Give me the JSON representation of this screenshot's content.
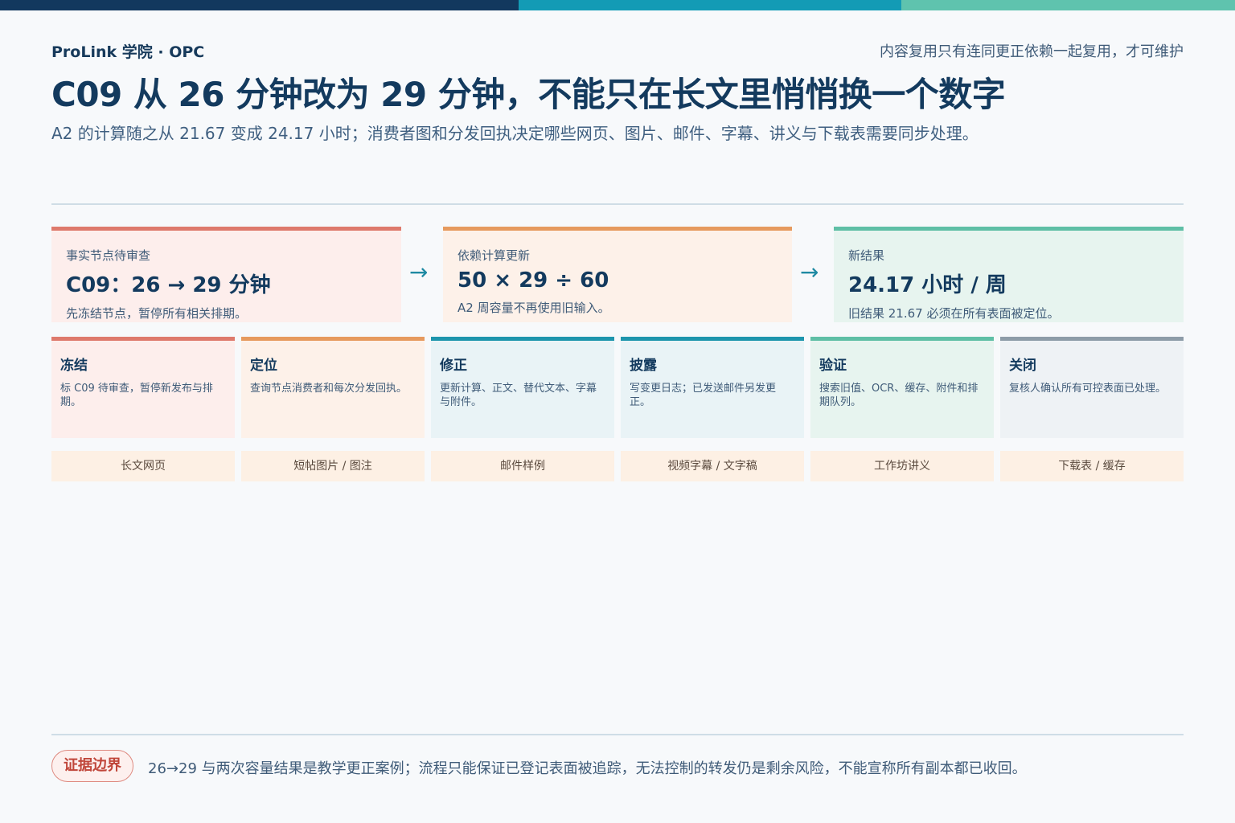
{
  "header": {
    "brand": "ProLink 学院 · OPC",
    "tagline": "内容复用只有连同更正依赖一起复用，才可维护",
    "title": "C09 从 26 分钟改为 29 分钟，不能只在长文里悄悄换一个数字",
    "subtitle": "A2 的计算随之从 21.67 变成 24.17 小时；消费者图和分发回执决定哪些网页、图片、邮件、字幕、讲义与下载表需要同步处理。"
  },
  "flow": [
    {
      "label": "事实节点待审查",
      "value": "C09：26 → 29 分钟",
      "note": "先冻结节点，暂停所有相关排期。"
    },
    {
      "label": "依赖计算更新",
      "value": "50 × 29 ÷ 60",
      "note": "A2 周容量不再使用旧输入。"
    },
    {
      "label": "新结果",
      "value": "24.17 小时 / 周",
      "note": "旧结果 21.67 必须在所有表面被定位。"
    }
  ],
  "flow_arrow": "→",
  "steps": [
    {
      "name": "冻结",
      "desc": "标 C09 待审查，暂停新发布与排期。"
    },
    {
      "name": "定位",
      "desc": "查询节点消费者和每次分发回执。"
    },
    {
      "name": "修正",
      "desc": "更新计算、正文、替代文本、字幕与附件。"
    },
    {
      "name": "披露",
      "desc": "写变更日志；已发送邮件另发更正。"
    },
    {
      "name": "验证",
      "desc": "搜索旧值、OCR、缓存、附件和排期队列。"
    },
    {
      "name": "关闭",
      "desc": "复核人确认所有可控表面已处理。"
    }
  ],
  "surfaces": [
    "长文网页",
    "短帖图片 / 图注",
    "邮件样例",
    "视频字幕 / 文字稿",
    "工作坊讲义",
    "下载表 / 缓存"
  ],
  "footer": {
    "badge": "证据边界",
    "text": "26→29 与两次容量结果是教学更正案例；流程只能保证已登记表面被追踪，无法控制的转发仍是剩余风险，不能宣称所有副本都已收回。"
  }
}
